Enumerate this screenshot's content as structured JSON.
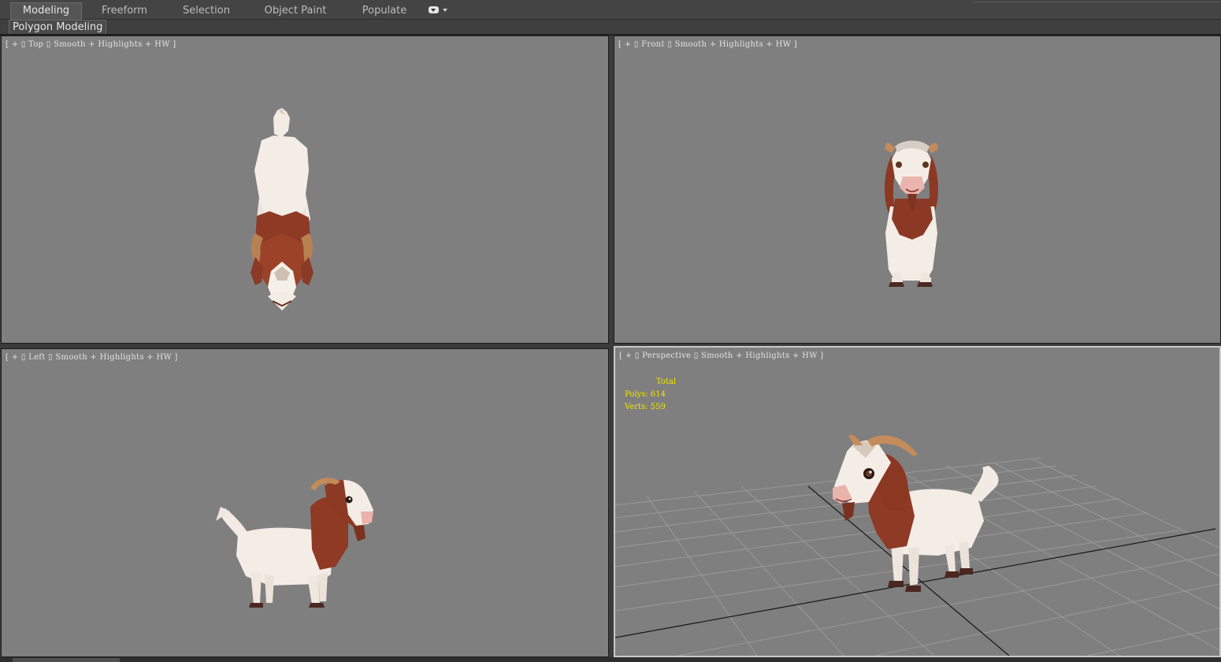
{
  "ribbon": {
    "tabs": [
      {
        "label": "Modeling",
        "active": true
      },
      {
        "label": "Freeform",
        "active": false
      },
      {
        "label": "Selection",
        "active": false
      },
      {
        "label": "Object Paint",
        "active": false
      },
      {
        "label": "Populate",
        "active": false
      }
    ]
  },
  "panel": {
    "label": "Polygon Modeling"
  },
  "viewports": {
    "top": {
      "plus": "+",
      "view": "Top",
      "shading": "Smooth + Highlights + HW"
    },
    "front": {
      "plus": "+",
      "view": "Front",
      "shading": "Smooth + Highlights + HW"
    },
    "left": {
      "plus": "+",
      "view": "Left",
      "shading": "Smooth + Highlights + HW"
    },
    "perspective": {
      "plus": "+",
      "view": "Perspective",
      "shading": "Smooth + Highlights + HW"
    }
  },
  "stats": {
    "header": "Total",
    "polys_label": "Polys:",
    "polys_value": "614",
    "verts_label": "Verts:",
    "verts_value": "559"
  },
  "colors": {
    "viewport_bg": "#7f7f7f",
    "stats_text": "#f2e400",
    "goat_brown": "#8e3a25",
    "goat_white": "#f4ede6"
  }
}
